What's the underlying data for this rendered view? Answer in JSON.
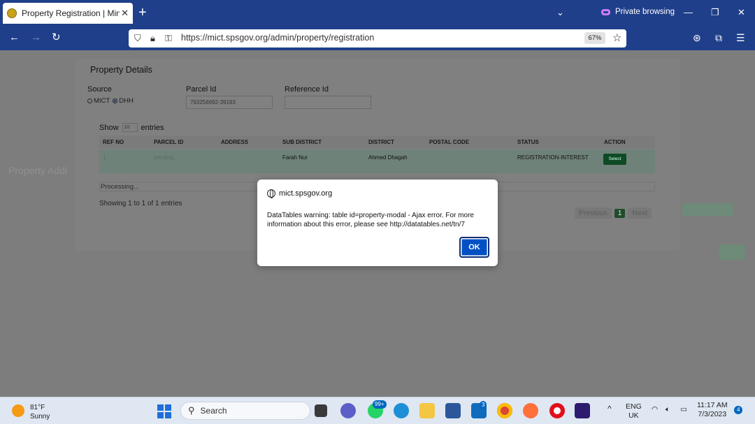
{
  "browser": {
    "tab_title": "Property Registration | Ministry",
    "tab_close": "✕",
    "new_tab": "+",
    "private_label": "Private browsing",
    "url": "https://mict.spsgov.org/admin/property/registration",
    "zoom": "67%"
  },
  "page": {
    "bg_title": "Property Addi",
    "modal": {
      "title": "Property Details",
      "source_label": "Source",
      "source_options": [
        "MICT",
        "DHH"
      ],
      "source_selected": "DHH",
      "parcel_label": "Parcel Id",
      "parcel_value": "763256692-39193",
      "reference_label": "Reference Id",
      "reference_value": "",
      "show_label": "Show",
      "show_value": "10",
      "entries_label": "entries",
      "columns": [
        "REF NO",
        "PARCEL ID",
        "ADDRESS",
        "SUB DISTRICT",
        "DISTRICT",
        "POSTAL CODE",
        "STATUS",
        "ACTION"
      ],
      "row": {
        "ref_no": "1",
        "parcel_id": "pending",
        "address": "",
        "sub_district": "Farah Nur",
        "district": "Ahmed Dhagah",
        "postal_code": "",
        "status": "REGISTRATION-INTEREST",
        "action": "Select"
      },
      "processing": "Processing...",
      "showing": "Showing 1 to 1 of 1 entries",
      "pager": {
        "previous": "Previous",
        "page": "1",
        "next": "Next"
      }
    }
  },
  "dialog": {
    "origin": "mict.spsgov.org",
    "message": "DataTables warning: table id=property-modal - Ajax error. For more information about this error, please see http://datatables.net/tn/7",
    "ok_label": "OK"
  },
  "taskbar": {
    "weather_temp": "81°F",
    "weather_desc": "Sunny",
    "search_placeholder": "Search",
    "whatsapp_badge": "99+",
    "mail_badge": "3",
    "lang_top": "ENG",
    "lang_bottom": "UK",
    "time": "11:17 AM",
    "date": "7/3/2023",
    "notif_count": "4"
  },
  "colors": {
    "chrome": "#1f3f8a",
    "ok_button": "#0050c4",
    "overlay": "#7d7d7d"
  }
}
